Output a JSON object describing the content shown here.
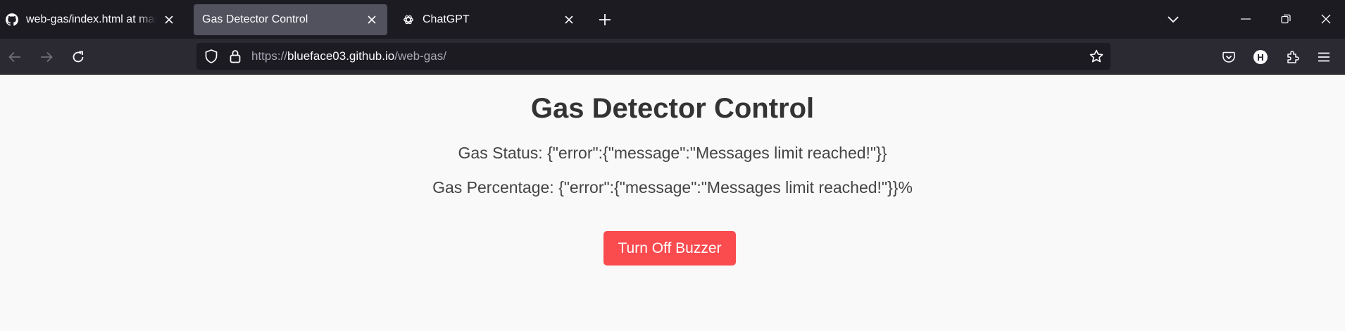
{
  "browser": {
    "tabs": [
      {
        "title": "web-gas/index.html at main · B",
        "icon": "github-icon",
        "active": false
      },
      {
        "title": "Gas Detector Control",
        "icon": "none",
        "active": true
      },
      {
        "title": "ChatGPT",
        "icon": "chatgpt-icon",
        "active": false
      }
    ],
    "url": {
      "scheme": "https://",
      "host": "blueface03.github.io",
      "path": "/web-gas/"
    },
    "toolbar_icons": [
      "back-icon",
      "forward-icon",
      "reload-icon",
      "shield-icon",
      "lock-icon",
      "star-icon",
      "pocket-icon",
      "extension-h-icon",
      "extensions-icon",
      "menu-icon"
    ],
    "colors": {
      "tabstrip": "#1c1b22",
      "active_tab": "#52525e",
      "navbar": "#2b2a33",
      "urlbar": "#1c1b22"
    }
  },
  "page": {
    "title": "Gas Detector Control",
    "gas_status_text": "Gas Status: {\"error\":{\"message\":\"Messages limit reached!\"}}",
    "gas_percentage_text": "Gas Percentage: {\"error\":{\"message\":\"Messages limit reached!\"}}%",
    "buzzer_button_label": "Turn Off Buzzer",
    "colors": {
      "background": "#f9f9f9",
      "title": "#333333",
      "text": "#444444",
      "button": "#fa4b4f",
      "button_text": "#ffffff"
    }
  }
}
